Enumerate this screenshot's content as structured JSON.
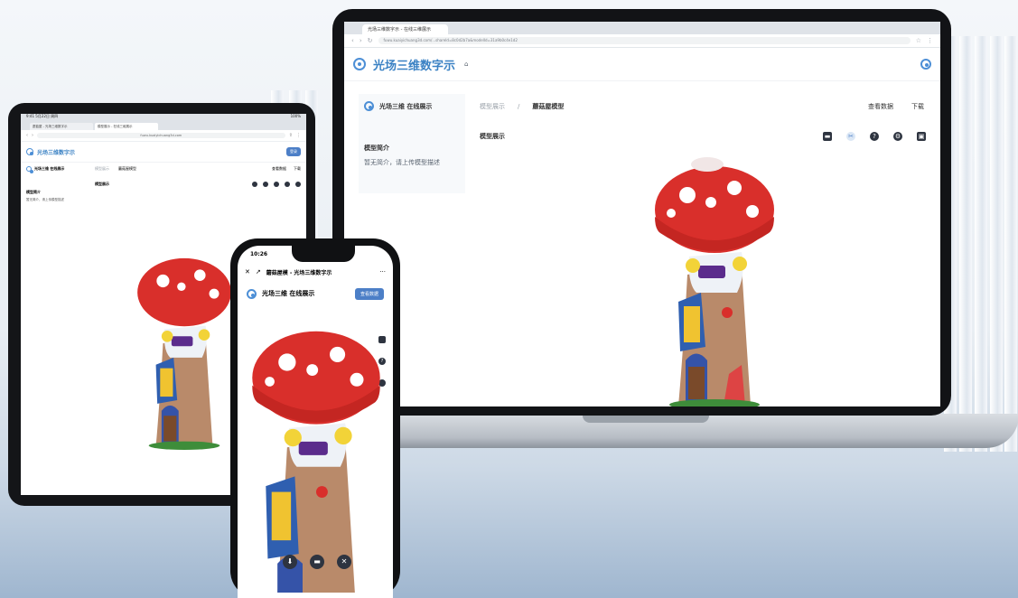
{
  "laptop": {
    "tab_title": "光场三维数字示 - 在线三维展示",
    "url": "fuwu.kuaiyichuang3d.com/...shareId=8c0d2b7a&modelId=31a9b0c4e1d2",
    "brand": "光场三维数字示",
    "sidebar_title": "光场三维 在线展示",
    "intro_title": "模型简介",
    "intro_text": "暂无简介，请上传模型描述",
    "breadcrumb_prev": "模型展示",
    "breadcrumb_sep": "/",
    "breadcrumb_current": "蘑菇屋模型",
    "section_title": "模型展示",
    "view_data_label": "查看数据",
    "download_label": "下载"
  },
  "tablet": {
    "status_left": "9:41  5月22日 周四",
    "status_right": "100%",
    "tab1": "蘑菇屋 - 光场三维数字示",
    "tab2": "模型展示 - 在线三维展示",
    "url": "fuwu.kuaiyichuang3d.com",
    "brand": "光场三维数字示",
    "sidebar_title": "光场三维 在线展示",
    "intro_title": "模型简介",
    "intro_text": "暂无简介，请上传模型描述",
    "breadcrumb_prev": "模型展示",
    "breadcrumb_current": "蘑菇屋模型",
    "section_title": "模型展示",
    "view_data_label": "查看数据",
    "download_label": "下载",
    "login_label": "登录"
  },
  "phone": {
    "time": "10:26",
    "title": "蘑菇屋模 - 光场三维数字示",
    "more": "···",
    "brand": "光场三维 在线展示",
    "action_label": "查看数据"
  },
  "colors": {
    "accent": "#4c7fc7",
    "brand_text": "#3b82c4",
    "cap_red": "#d92f2b"
  },
  "icons": [
    "close-icon",
    "share-icon",
    "more-icon",
    "message-icon",
    "crop-icon",
    "help-icon",
    "gear-icon",
    "layers-icon",
    "download-icon",
    "mushroom-house-model"
  ]
}
